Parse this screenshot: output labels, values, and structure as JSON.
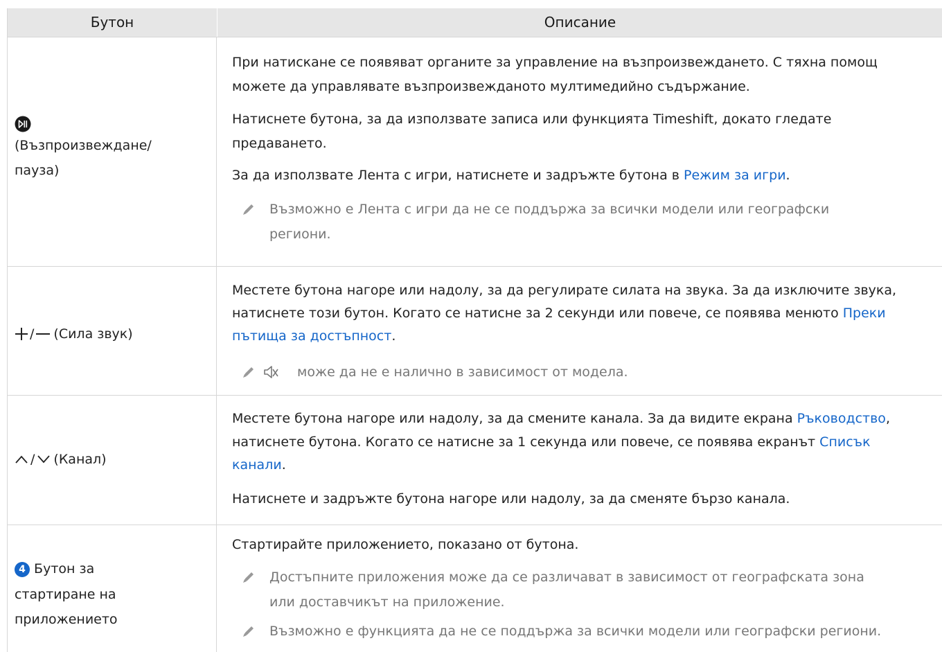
{
  "header": {
    "col_button": "Бутон",
    "col_description": "Описание"
  },
  "rows": [
    {
      "button_label_1": "(Възпроизвеждане/",
      "button_label_2": "пауза)",
      "paragraphs": [
        {
          "t1": "При натискане се появяват органите за управление на възпроизвеждането. С тяхна помощ",
          "t2": "можете да управлявате възпроизвежданото мултимедийно съдържание."
        },
        {
          "t1": "Натиснете бутона, за да използвате записа или функцията Timeshift, докато гледате",
          "t2": "предаването."
        },
        {
          "pre": "За да използвате Лента с игри, натиснете и задръжте бутона в ",
          "link": "Режим за игри",
          "post": "."
        }
      ],
      "note": {
        "t1": "Възможно е Лента с игри да не се поддържа за всички модели или географски",
        "t2": "региони."
      }
    },
    {
      "button_label": "(Сила звук)",
      "paragraphs": [
        {
          "t1": "Местете бутона нагоре или надолу, за да регулирате силата на звука. За да изключите звука,",
          "t2_pre": "натиснете този бутон. Когато се натисне за 2 секунди или повече, се появява менюто ",
          "t2_link": "Преки",
          "t3_link": "пътища за достъпност",
          "t3_post": "."
        }
      ],
      "note": {
        "t1": "може да не е налично в зависимост от модела."
      }
    },
    {
      "button_label": "(Канал)",
      "paragraphs": [
        {
          "t1_pre": "Местете бутона нагоре или надолу, за да смените канала. За да видите екрана ",
          "t1_link": "Ръководство",
          "t1_post": ",",
          "t2_pre": "натиснете бутона. Когато се натисне за 1 секунда или повече, се появява екранът ",
          "t2_link": "Списък",
          "t3_link": "канали",
          "t3_post": "."
        },
        {
          "t1": "Натиснете и задръжте бутона нагоре или надолу, за да сменяте бързо канала."
        }
      ]
    },
    {
      "badge": "4",
      "button_label_1": "Бутон за",
      "button_label_2": "стартиране на",
      "button_label_3": "приложението",
      "paragraphs": [
        {
          "t1": "Стартирайте приложението, показано от бутона."
        }
      ],
      "notes": [
        {
          "t1": "Достъпните приложения може да се различават в зависимост от географската зона",
          "t2": "или доставчикът на приложение."
        },
        {
          "t1": "Възможно е функцията да не се поддържа за всички модели или географски региони."
        }
      ]
    }
  ],
  "colors": {
    "link": "#1566c9",
    "header_bg": "#e6e6e6",
    "note_text": "#777777"
  }
}
